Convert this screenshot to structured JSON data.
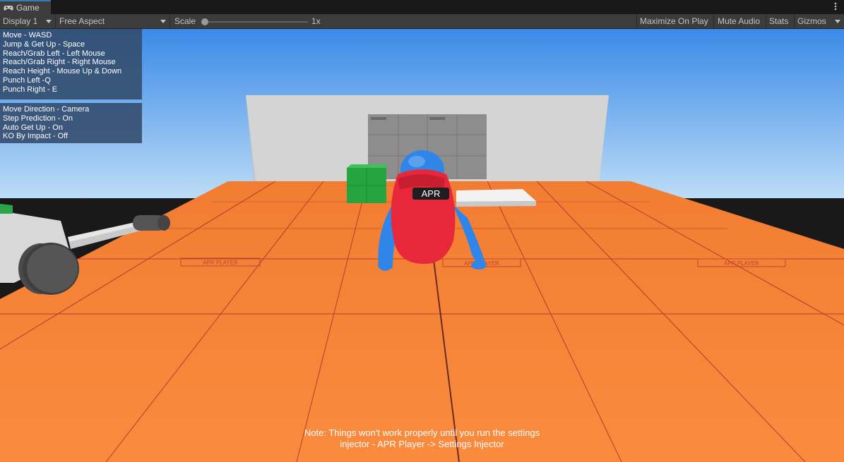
{
  "tab": {
    "title": "Game",
    "icon": "gamepad-icon",
    "menu_icon": "kebab-menu-icon"
  },
  "toolbar": {
    "display": "Display 1",
    "aspect": "Free Aspect",
    "scale_label": "Scale",
    "scale_value": "1x",
    "maximize": "Maximize On Play",
    "mute": "Mute Audio",
    "stats": "Stats",
    "gizmos": "Gizmos"
  },
  "controls": [
    "Move - WASD",
    "Jump & Get Up - Space",
    "Reach/Grab Left - Left Mouse",
    "Reach/Grab Right - Right Mouse",
    "Reach Height - Mouse Up & Down",
    "Punch Left -Q",
    "Punch Right - E"
  ],
  "settings": [
    "Move Direction - Camera",
    "Step Prediction - On",
    "Auto Get Up - On",
    "KO By Impact - Off"
  ],
  "character_label": "APR",
  "floor_labels": [
    "APR PLAYER",
    "APR PLAYER",
    "APR PLAYER"
  ],
  "note_line1": "Note: Things won't work properly until you run the settings",
  "note_line2": "injector - APR Player -> Settings Injector",
  "colors": {
    "sky_top": "#3a8ae8",
    "sky_bottom": "#bcdcf6",
    "floor": "#f98a3c",
    "floor_line": "#b73a2a",
    "wall": "#d6d6d6",
    "character_body": "#2f86e8",
    "character_vest": "#e8283a",
    "box": "#21a640",
    "panel": "#344c6e"
  }
}
